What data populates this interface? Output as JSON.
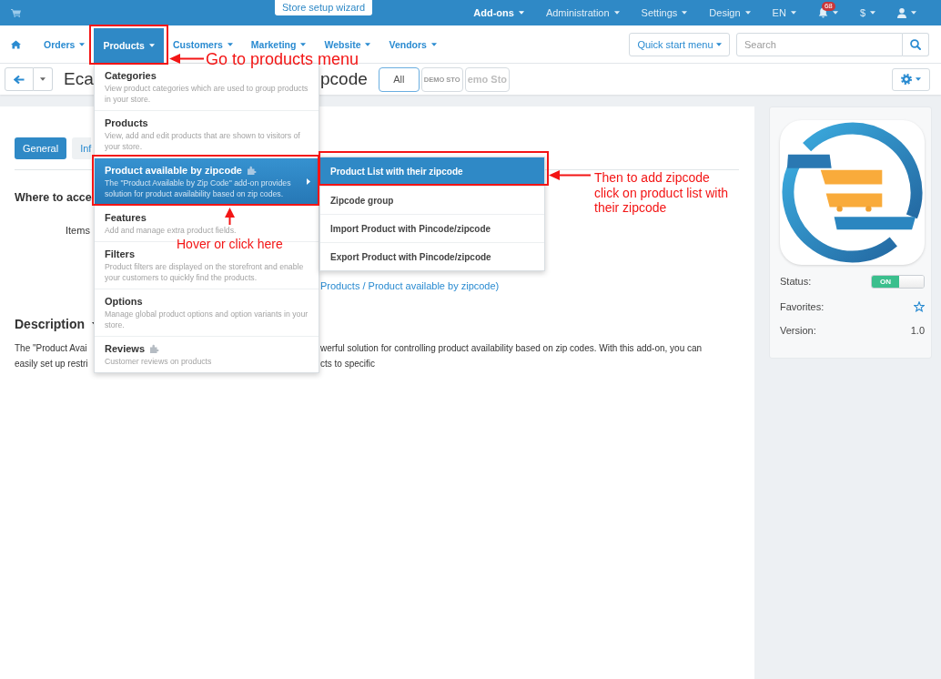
{
  "top_bar": {
    "wizard": "Store setup wizard",
    "menu": [
      {
        "kind": "text",
        "label": "Add-ons",
        "selected": true
      },
      {
        "kind": "text",
        "label": "Administration",
        "selected": false
      },
      {
        "kind": "text",
        "label": "Settings",
        "selected": false
      },
      {
        "kind": "text",
        "label": "Design",
        "selected": false
      },
      {
        "kind": "text",
        "label": "EN",
        "selected": false
      },
      {
        "kind": "bell",
        "badge": "68",
        "selected": false
      },
      {
        "kind": "text",
        "label": "$",
        "selected": false
      },
      {
        "kind": "user",
        "selected": false
      }
    ]
  },
  "nav": {
    "items": [
      {
        "label": "Orders",
        "selected": false
      },
      {
        "label": "Products",
        "selected": true
      },
      {
        "label": "Customers",
        "selected": false
      },
      {
        "label": "Marketing",
        "selected": false
      },
      {
        "label": "Website",
        "selected": false
      },
      {
        "label": "Vendors",
        "selected": false
      }
    ],
    "quick_start": "Quick start menu",
    "search": {
      "placeholder": "Search"
    }
  },
  "products_menu": {
    "items": [
      {
        "title": "Categories",
        "description": "View product categories which are used to group products in your store.",
        "addon": false,
        "selected": false
      },
      {
        "title": "Products",
        "description": "View, add and edit products that are shown to visitors of your store.",
        "addon": false,
        "selected": false
      },
      {
        "title": "Product available by zipcode",
        "description": "The \"Product Available by Zip Code\" add-on provides solution for product availability based on zip codes.",
        "addon": true,
        "selected": true,
        "submenu": [
          {
            "label": "Product List with their zipcode",
            "selected": true
          },
          {
            "label": "Zipcode group",
            "selected": false
          },
          {
            "label": "Import Product with Pincode/zipcode",
            "selected": false
          },
          {
            "label": "Export Product with Pincode/zipcode",
            "selected": false
          }
        ]
      },
      {
        "title": "Features",
        "description": "Add and manage extra product fields.",
        "addon": false,
        "selected": false
      },
      {
        "title": "Filters",
        "description": "Product filters are displayed on the storefront and enable your customers to quickly find the products.",
        "addon": false,
        "selected": false
      },
      {
        "title": "Options",
        "description": "Manage global product options and option variants in your store.",
        "addon": false,
        "selected": false
      },
      {
        "title": "Reviews",
        "description": "Customer reviews on products",
        "addon": true,
        "selected": false
      }
    ]
  },
  "title_bar": {
    "title_start": "Eca",
    "title_end": "pcode",
    "storefronts": [
      {
        "kind": "label",
        "label": "All",
        "selected": true
      },
      {
        "kind": "logo",
        "label": "DEMO STO",
        "selected": false
      },
      {
        "kind": "wordmark",
        "label": "emo Sto",
        "selected": false
      }
    ]
  },
  "content": {
    "tabs": [
      {
        "label": "General",
        "selected": true
      },
      {
        "label": "Inf",
        "selected": false
      }
    ],
    "heading": "Where to acce",
    "items_label": "Items",
    "link": "Products / Product available by zipcode)",
    "description": {
      "heading": "Description",
      "lines": [
        {
          "start": "The \"Product Avai",
          "end": "werful solution for controlling product availability based on zip codes. With this add-on, you can"
        },
        {
          "start": "easily set up restri",
          "end": "cts to specific"
        }
      ]
    }
  },
  "side_panel": {
    "status": {
      "label": "Status:",
      "toggle": "ON",
      "on": true
    },
    "favorites": {
      "label": "Favorites:",
      "starred": false
    },
    "version": {
      "label": "Version:",
      "value": "1.0"
    }
  },
  "annotations": [
    {
      "text": "Go to products menu"
    },
    {
      "text": "Hover or click here"
    },
    {
      "text": "Then to add zipcode\nclick on product list with\ntheir zipcode"
    }
  ]
}
